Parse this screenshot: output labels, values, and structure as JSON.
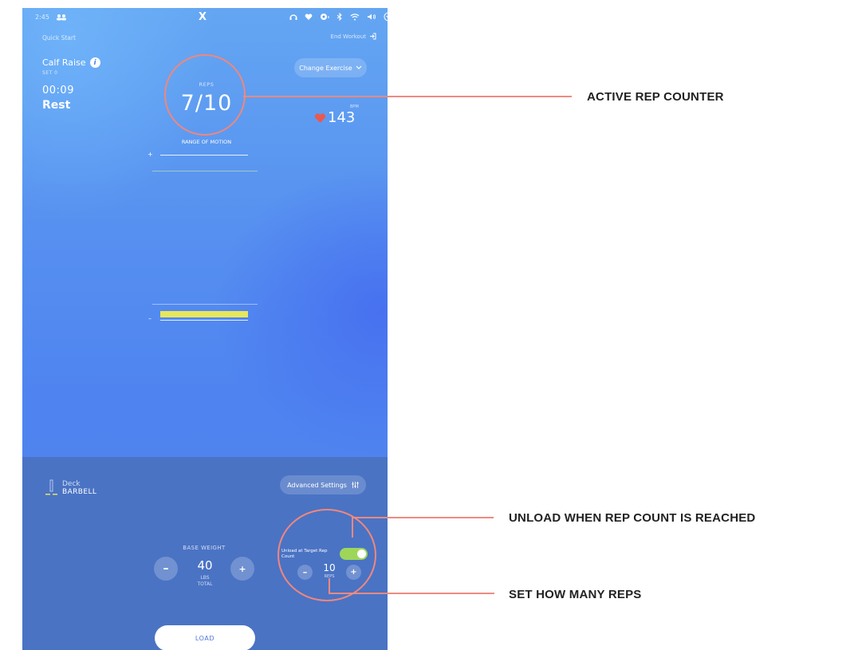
{
  "status_bar": {
    "time": "2:45",
    "logo": "X",
    "icons": [
      "people-icon",
      "headphones-icon",
      "heart-icon",
      "location-icon",
      "bluetooth-icon",
      "wifi-icon",
      "volume-icon",
      "chevron-down-circle-icon"
    ]
  },
  "header": {
    "quick_start": "Quick Start",
    "end_workout": "End Workout"
  },
  "exercise": {
    "name": "Calf Raise",
    "set": "SET 0",
    "timer": "00:09",
    "state": "Rest"
  },
  "change_exercise": "Change Exercise",
  "reps": {
    "label": "REPS",
    "value": "7/10"
  },
  "heart": {
    "label": "BPM",
    "value": "143"
  },
  "range_of_motion": {
    "label": "RANGE OF MOTION",
    "plus": "+",
    "minus": "–"
  },
  "attachment": {
    "title": "Deck",
    "name": "BARBELL"
  },
  "advanced_settings": "Advanced Settings",
  "base_weight": {
    "label": "BASE WEIGHT",
    "value": "40",
    "unit": "LBS",
    "sub": "TOTAL",
    "minus": "–",
    "plus": "+"
  },
  "unload": {
    "label": "Unload at Target Rep Count",
    "enabled": true,
    "value": "10",
    "unit": "REPS",
    "minus": "–",
    "plus": "+"
  },
  "load_button": "LOAD",
  "callouts": {
    "rep_counter": "ACTIVE REP COUNTER",
    "unload": "UNLOAD WHEN REP COUNT IS REACHED",
    "set_reps": "SET HOW MANY REPS"
  },
  "colors": {
    "accent_highlight": "#e8e65a",
    "toggle_on": "#9ed65a",
    "callout": "#f08a80"
  }
}
